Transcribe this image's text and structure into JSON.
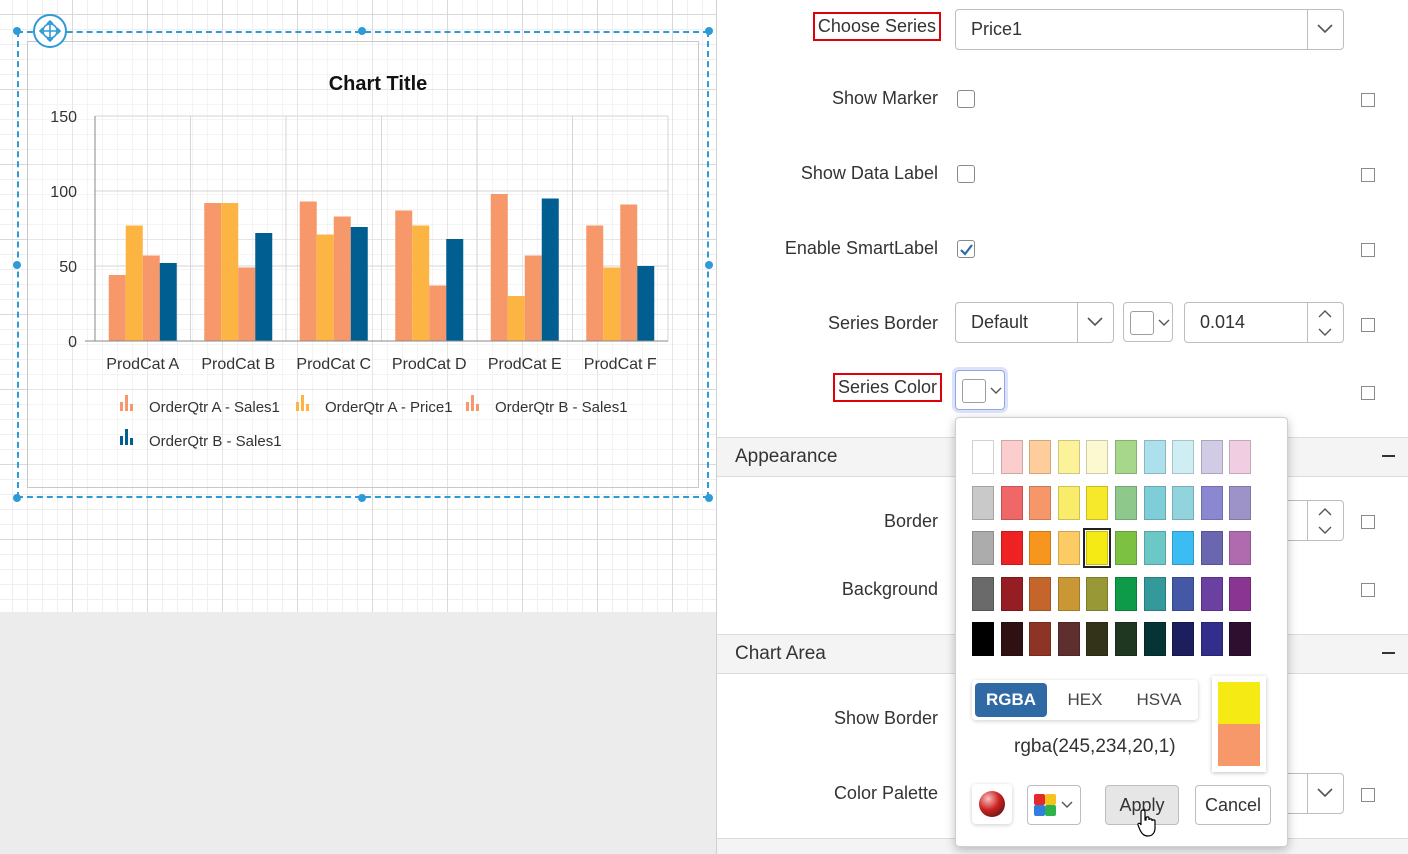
{
  "chart_data": {
    "type": "bar",
    "title": "Chart Title",
    "categories": [
      "ProdCat A",
      "ProdCat B",
      "ProdCat C",
      "ProdCat D",
      "ProdCat E",
      "ProdCat F"
    ],
    "ylim": [
      0,
      150
    ],
    "yticks": [
      "0",
      "50",
      "100",
      "150"
    ],
    "grid": true,
    "legend_position": "bottom",
    "series": [
      {
        "name": "OrderQtr A - Sales1",
        "color": "#f7986b",
        "values": [
          44,
          92,
          93,
          87,
          98,
          77
        ]
      },
      {
        "name": "OrderQtr A - Price1",
        "color": "#fcb443",
        "values": [
          77,
          92,
          71,
          77,
          30,
          49
        ]
      },
      {
        "name": "OrderQtr B - Sales1",
        "color": "#f7986b",
        "values": [
          57,
          49,
          83,
          37,
          57,
          91
        ]
      },
      {
        "name": "OrderQtr B - Sales1",
        "color": "#005e91",
        "values": [
          52,
          72,
          76,
          68,
          95,
          50
        ]
      }
    ]
  },
  "panel": {
    "choose_series_label": "Choose Series",
    "choose_series_value": "Price1",
    "show_marker_label": "Show Marker",
    "show_data_label_label": "Show Data Label",
    "enable_smartlabel_label": "Enable SmartLabel",
    "series_border_label": "Series Border",
    "series_border_style": "Default",
    "series_border_width": "0.014",
    "series_color_label": "Series Color",
    "appearance_section": "Appearance",
    "border_label": "Border",
    "background_label": "Background",
    "chart_area_section": "Chart Area",
    "show_border_label": "Show Border",
    "color_palette_label": "Color Palette"
  },
  "picker": {
    "mode_rgba": "RGBA",
    "mode_hex": "HEX",
    "mode_hsva": "HSVA",
    "value_text": "rgba(245,234,20,1)",
    "new_color": "#f5ea14",
    "old_color": "#f7986b",
    "apply_label": "Apply",
    "cancel_label": "Cancel",
    "palette_rows": [
      [
        "#ffffff",
        "#fccdcd",
        "#fdcd9c",
        "#fbf29a",
        "#fcf8d0",
        "#a6d78a",
        "#abe0ec",
        "#cfeef4",
        "#d1cbe5",
        "#f1cde2"
      ],
      [
        "#c9c9c9",
        "#ef6767",
        "#f69769",
        "#f9ec6b",
        "#f6e92c",
        "#8ec98b",
        "#7fcdd9",
        "#91d4de",
        "#8c87d1",
        "#9e93c9"
      ],
      [
        "#acacac",
        "#ee2222",
        "#f7961e",
        "#fccb64",
        "#f5ea14",
        "#7cc142",
        "#6cc7c7",
        "#3bbdf3",
        "#6a67b0",
        "#b06aae"
      ],
      [
        "#6a6a6a",
        "#941e23",
        "#c4652b",
        "#c99733",
        "#989837",
        "#0d9a49",
        "#34999a",
        "#4558a6",
        "#6a40a0",
        "#8b3593"
      ],
      [
        "#000000",
        "#2f1113",
        "#8e3426",
        "#5f2f2f",
        "#333319",
        "#1f3621",
        "#063434",
        "#1c1e5d",
        "#332e8b",
        "#2f0f2f"
      ]
    ],
    "selected_color": "#f5ea14"
  }
}
